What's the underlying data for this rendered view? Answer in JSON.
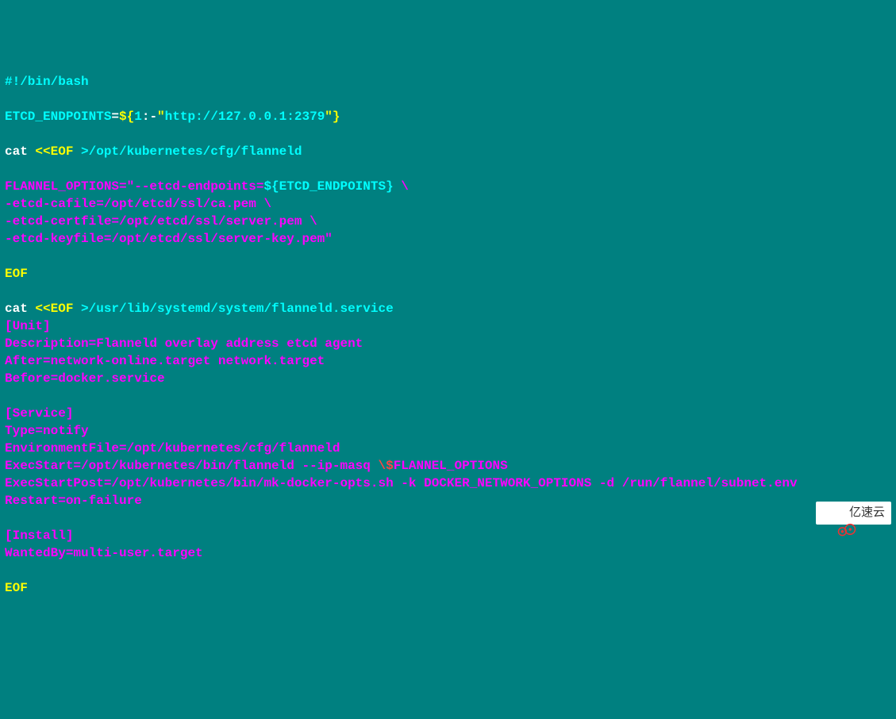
{
  "lines": [
    {
      "segments": [
        {
          "text": "#!/bin/bash",
          "cls": "cyan"
        }
      ]
    },
    {
      "segments": []
    },
    {
      "segments": [
        {
          "text": "ETCD_ENDPOINTS",
          "cls": "cyan"
        },
        {
          "text": "=",
          "cls": "white"
        },
        {
          "text": "${",
          "cls": "yellow"
        },
        {
          "text": "1",
          "cls": "cyan"
        },
        {
          "text": ":-",
          "cls": "white"
        },
        {
          "text": "\"",
          "cls": "yellow"
        },
        {
          "text": "http://127.0.0.1:2379",
          "cls": "cyan"
        },
        {
          "text": "\"",
          "cls": "yellow"
        },
        {
          "text": "}",
          "cls": "yellow"
        }
      ]
    },
    {
      "segments": []
    },
    {
      "segments": [
        {
          "text": "cat ",
          "cls": "white"
        },
        {
          "text": "<<EOF ",
          "cls": "yellow"
        },
        {
          "text": ">/opt/kubernetes/cfg/flanneld",
          "cls": "cyan"
        }
      ]
    },
    {
      "segments": []
    },
    {
      "segments": [
        {
          "text": "FLANNEL_OPTIONS=\"--etcd-endpoints=",
          "cls": "magenta"
        },
        {
          "text": "${ETCD_ENDPOINTS}",
          "cls": "cyan"
        },
        {
          "text": " \\",
          "cls": "magenta"
        }
      ]
    },
    {
      "segments": [
        {
          "text": "-etcd-cafile=/opt/etcd/ssl/ca.pem \\",
          "cls": "magenta"
        }
      ]
    },
    {
      "segments": [
        {
          "text": "-etcd-certfile=/opt/etcd/ssl/server.pem \\",
          "cls": "magenta"
        }
      ]
    },
    {
      "segments": [
        {
          "text": "-etcd-keyfile=/opt/etcd/ssl/server-key.pem\"",
          "cls": "magenta"
        }
      ]
    },
    {
      "segments": []
    },
    {
      "segments": [
        {
          "text": "EOF",
          "cls": "yellow"
        }
      ]
    },
    {
      "segments": []
    },
    {
      "segments": [
        {
          "text": "cat ",
          "cls": "white"
        },
        {
          "text": "<<EOF ",
          "cls": "yellow"
        },
        {
          "text": ">/usr/lib/systemd/system/flanneld.service",
          "cls": "cyan"
        }
      ]
    },
    {
      "segments": [
        {
          "text": "[Unit]",
          "cls": "magenta"
        }
      ]
    },
    {
      "segments": [
        {
          "text": "Description=Flanneld overlay address etcd agent",
          "cls": "magenta"
        }
      ]
    },
    {
      "segments": [
        {
          "text": "After=network-online.target network.target",
          "cls": "magenta"
        }
      ]
    },
    {
      "segments": [
        {
          "text": "Before=docker.service",
          "cls": "magenta"
        }
      ]
    },
    {
      "segments": []
    },
    {
      "segments": [
        {
          "text": "[Service]",
          "cls": "magenta"
        }
      ]
    },
    {
      "segments": [
        {
          "text": "Type=notify",
          "cls": "magenta"
        }
      ]
    },
    {
      "segments": [
        {
          "text": "EnvironmentFile=/opt/kubernetes/cfg/flanneld",
          "cls": "magenta"
        }
      ]
    },
    {
      "segments": [
        {
          "text": "ExecStart=/opt/kubernetes/bin/flanneld --ip-masq ",
          "cls": "magenta"
        },
        {
          "text": "\\$",
          "cls": "red"
        },
        {
          "text": "FLANNEL_OPTIONS",
          "cls": "magenta"
        }
      ]
    },
    {
      "segments": [
        {
          "text": "ExecStartPost=/opt/kubernetes/bin/mk-docker-opts.sh -k DOCKER_NETWORK_OPTIONS -d /run/flannel/subnet.env",
          "cls": "magenta"
        }
      ]
    },
    {
      "segments": [
        {
          "text": "Restart=on-failure",
          "cls": "magenta"
        }
      ]
    },
    {
      "segments": []
    },
    {
      "segments": [
        {
          "text": "[Install]",
          "cls": "magenta"
        }
      ]
    },
    {
      "segments": [
        {
          "text": "WantedBy=multi-user.target",
          "cls": "magenta"
        }
      ]
    },
    {
      "segments": []
    },
    {
      "segments": [
        {
          "text": "EOF",
          "cls": "yellow"
        }
      ]
    }
  ],
  "watermark": {
    "text": "亿速云"
  }
}
